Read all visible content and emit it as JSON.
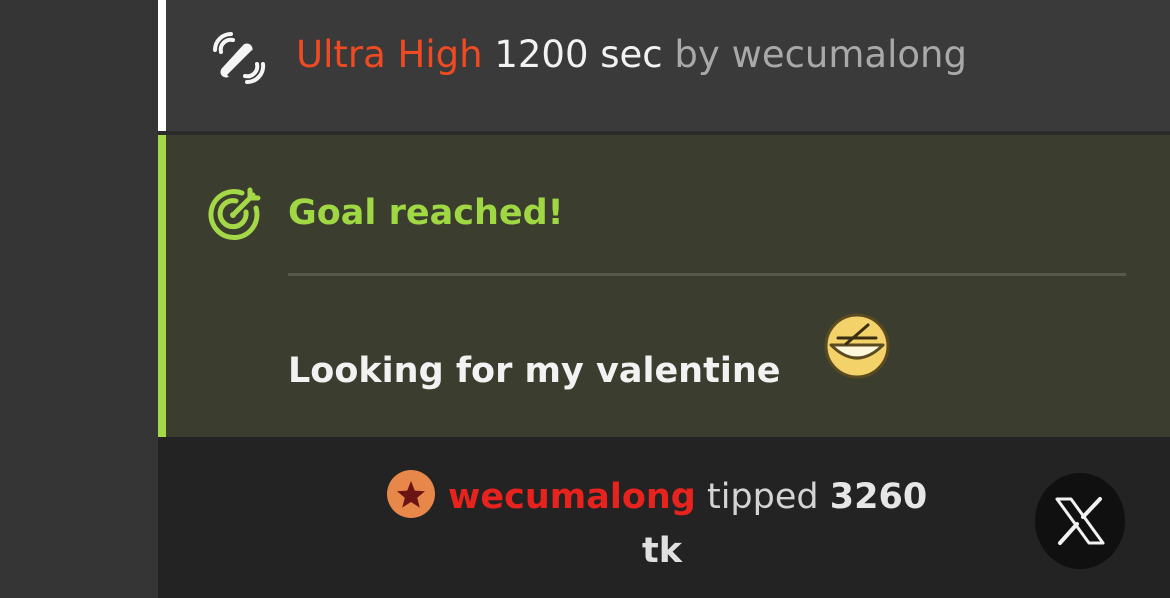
{
  "vibe": {
    "level": "Ultra High",
    "duration": "1200 sec",
    "by_label": "by",
    "user": "wecumalong",
    "icon": "vibrate-icon"
  },
  "goal": {
    "title": "Goal reached!",
    "subject": "Looking for my valentine",
    "icon": "target-icon",
    "emoji": "shy-face-emoji"
  },
  "tip": {
    "user": "wecumalong",
    "verb": "tipped",
    "amount": "3260",
    "unit": "tk",
    "badge_icon": "star-badge-icon"
  },
  "social": {
    "icon": "x-logo-icon"
  },
  "colors": {
    "vibe_level": "#ef4a22",
    "goal_accent": "#a4d846",
    "tipper": "#e8231e",
    "badge": "#e8874a"
  }
}
